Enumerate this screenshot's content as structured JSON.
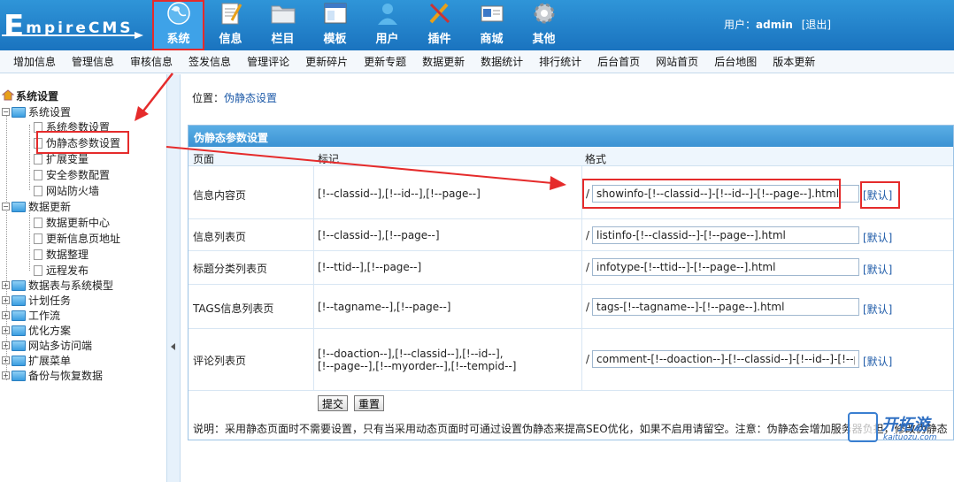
{
  "header": {
    "logo_first": "E",
    "logo_rest": "mpireCMS",
    "nav": [
      {
        "label": "系统",
        "icon": "globe-icon",
        "active": true
      },
      {
        "label": "信息",
        "icon": "notepad-icon"
      },
      {
        "label": "栏目",
        "icon": "folder-icon"
      },
      {
        "label": "模板",
        "icon": "window-icon"
      },
      {
        "label": "用户",
        "icon": "user-icon"
      },
      {
        "label": "插件",
        "icon": "tools-icon"
      },
      {
        "label": "商城",
        "icon": "card-icon"
      },
      {
        "label": "其他",
        "icon": "gear-icon"
      }
    ],
    "user_label": "用户：",
    "username": "admin",
    "logout": "[退出]"
  },
  "subnav": [
    "增加信息",
    "管理信息",
    "审核信息",
    "签发信息",
    "管理评论",
    "更新碎片",
    "更新专题",
    "数据更新",
    "数据统计",
    "排行统计",
    "后台首页",
    "网站首页",
    "后台地图",
    "版本更新"
  ],
  "tree": {
    "root": "系统设置",
    "groups": [
      {
        "label": "系统设置",
        "children": [
          "系统参数设置",
          "伪静态参数设置",
          "扩展变量",
          "安全参数配置",
          "网站防火墙"
        ]
      },
      {
        "label": "数据更新",
        "children": [
          "数据更新中心",
          "更新信息页地址",
          "数据整理",
          "远程发布"
        ]
      },
      {
        "label": "数据表与系统模型"
      },
      {
        "label": "计划任务"
      },
      {
        "label": "工作流"
      },
      {
        "label": "优化方案"
      },
      {
        "label": "网站多访问端"
      },
      {
        "label": "扩展菜单"
      },
      {
        "label": "备份与恢复数据"
      }
    ]
  },
  "location": {
    "prefix": "位置：",
    "link": "伪静态设置"
  },
  "panel": {
    "title": "伪静态参数设置",
    "columns": [
      "页面",
      "标记",
      "格式"
    ],
    "rows": [
      {
        "name": "信息内容页",
        "tags": "[!--classid--],[!--id--],[!--page--]",
        "tags2": "",
        "format": "showinfo-[!--classid--]-[!--id--]-[!--page--].html"
      },
      {
        "name": "信息列表页",
        "tags": "[!--classid--],[!--page--]",
        "tags2": "",
        "format": "listinfo-[!--classid--]-[!--page--].html"
      },
      {
        "name": "标题分类列表页",
        "tags": "[!--ttid--],[!--page--]",
        "tags2": "",
        "format": "infotype-[!--ttid--]-[!--page--].html"
      },
      {
        "name": "TAGS信息列表页",
        "tags": "[!--tagname--],[!--page--]",
        "tags2": "",
        "format": "tags-[!--tagname--]-[!--page--].html"
      },
      {
        "name": "评论列表页",
        "tags": "[!--doaction--],[!--classid--],[!--id--],",
        "tags2": "[!--page--],[!--myorder--],[!--tempid--]",
        "format": "comment-[!--doaction--]-[!--classid--]-[!--id--]-[!--page--]-[!--myorder--]-[!--tempid--].html"
      }
    ],
    "slash": "/",
    "default_link": "[默认]",
    "submit": "提交",
    "reset": "重置",
    "note": "说明：采用静态页面时不需要设置，只有当采用动态页面时可通过设置伪静态来提高SEO优化，如果不启用请留空。注意：伪静态会增加服务器负担，修改伪静态"
  },
  "watermark": {
    "text": "开拓游",
    "sub": "kaituozu.com"
  },
  "colors": {
    "header_blue": "#1a73bf",
    "annotation_red": "#e52b2b",
    "link_blue": "#1d5aa8"
  }
}
